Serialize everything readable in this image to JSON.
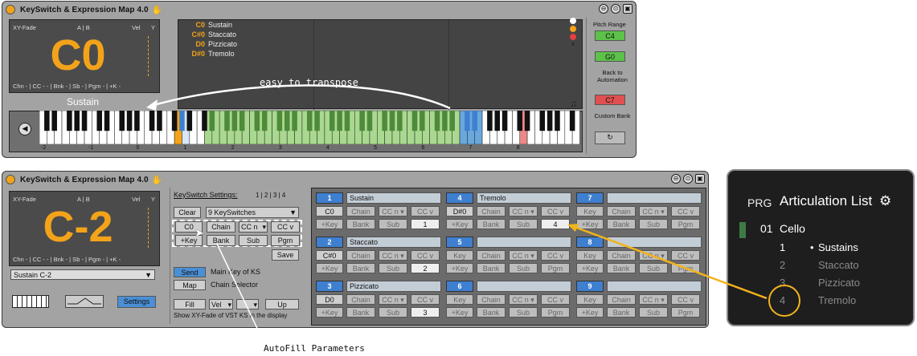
{
  "top": {
    "title": "KeySwitch & Expression Map 4.0",
    "display_labels": {
      "xyfade": "XY-Fade",
      "ab": "A | B",
      "vel": "Vel",
      "y": "Y"
    },
    "note": "C0",
    "footer": "Chn - | CC - - | Bnk - | Sb - | Pgm - | +K -",
    "articulation_label": "Sustain",
    "keyswitches": [
      {
        "key": "C0",
        "name": "Sustain"
      },
      {
        "key": "C#0",
        "name": "Staccato"
      },
      {
        "key": "D0",
        "name": "Pizzicato"
      },
      {
        "key": "D#0",
        "name": "Tremolo"
      }
    ],
    "annotation": "easy to transpose",
    "octave_labels": [
      "-2",
      "-1",
      "0",
      "1",
      "2",
      "3",
      "4",
      "5",
      "6",
      "7",
      "8"
    ],
    "pitch_range": {
      "label": "Pitch Range",
      "high": "C4",
      "low": "G0"
    },
    "automation": {
      "label": "Back to Automation",
      "value": "C7"
    },
    "custom_bank": {
      "label": "Custom Bank"
    }
  },
  "bottom": {
    "title": "KeySwitch & Expression Map 4.0",
    "display_labels": {
      "xyfade": "XY-Fade",
      "ab": "A | B",
      "vel": "Vel",
      "y": "Y"
    },
    "note": "C-2",
    "footer": "Chn - | CC - - | Bnk - | Sb - | Pgm - | +K -",
    "dropdown": "Sustain C-2",
    "settings_btn": "Settings",
    "ks_settings": {
      "title": "KeySwitch Settings:",
      "pages": "1 | 2 | 3 | 4",
      "clear": "Clear",
      "count": "9 KeySwitches",
      "row1": [
        "C0",
        "Chain",
        "CC n",
        "CC v"
      ],
      "row2": [
        "+Key",
        "Bank",
        "Sub",
        "Pgm"
      ],
      "save": "Save",
      "send": "Send",
      "send_desc": "Main Key of KS",
      "map": "Map",
      "map_desc": "Chain Selector",
      "fill": "Fill",
      "vel": "Vel",
      "up": "Up",
      "footer": "Show XY-Fade of VST KS in the display"
    },
    "slots": [
      {
        "n": "1",
        "name": "Sustain",
        "key": "C0",
        "v": "1"
      },
      {
        "n": "4",
        "name": "Tremolo",
        "key": "D#0",
        "v": "4"
      },
      {
        "n": "7",
        "name": "",
        "key": "+Key",
        "v": ""
      },
      {
        "n": "2",
        "name": "Staccato",
        "key": "C#0",
        "v": "2"
      },
      {
        "n": "5",
        "name": "",
        "key": "Key",
        "v": ""
      },
      {
        "n": "8",
        "name": "",
        "key": "Key",
        "v": ""
      },
      {
        "n": "3",
        "name": "Pizzicato",
        "key": "D0",
        "v": "3"
      },
      {
        "n": "6",
        "name": "",
        "key": "Key",
        "v": ""
      },
      {
        "n": "9",
        "name": "",
        "key": "Key",
        "v": ""
      }
    ],
    "slot_labels": {
      "chain": "Chain",
      "ccn": "CC n",
      "ccv": "CC v",
      "key": "+Key",
      "bank": "Bank",
      "sub": "Sub",
      "pgm": "Pgm"
    }
  },
  "articulation_list": {
    "prg": "PRG",
    "title": "Articulation List",
    "program": {
      "num": "01",
      "name": "Cello"
    },
    "items": [
      {
        "num": "1",
        "name": "Sustains",
        "active": true
      },
      {
        "num": "2",
        "name": "Staccato",
        "active": false
      },
      {
        "num": "3",
        "name": "Pizzicato",
        "active": false
      },
      {
        "num": "4",
        "name": "Tremolo",
        "active": false
      }
    ]
  },
  "callout": "AutoFill Parameters",
  "colors": {
    "accent": "#f3a31a",
    "blue": "#3f7fd0",
    "green": "#7cc25a",
    "red": "#e05050",
    "callout": "#f2b41b"
  }
}
